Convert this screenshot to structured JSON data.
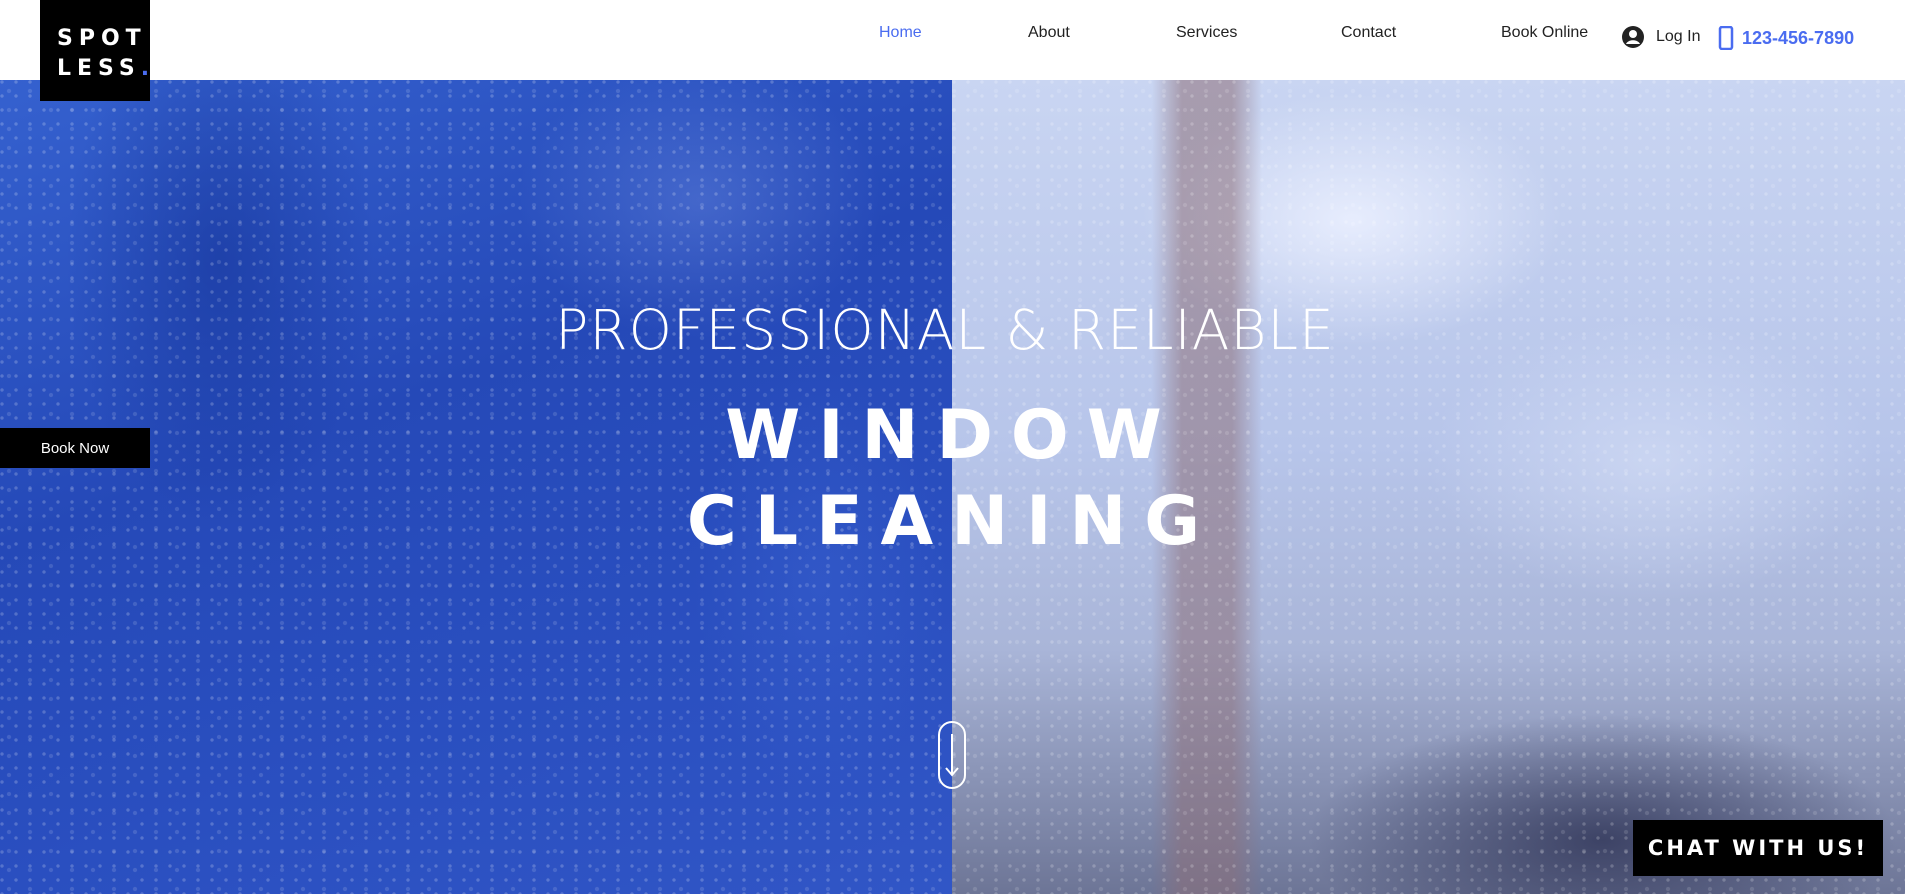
{
  "logo": {
    "line1": "SPOT",
    "line2": "LESS",
    "dot": "."
  },
  "nav": {
    "items": [
      {
        "label": "Home",
        "active": true
      },
      {
        "label": "About",
        "active": false
      },
      {
        "label": "Services",
        "active": false
      },
      {
        "label": "Contact",
        "active": false
      },
      {
        "label": "Book Online",
        "active": false
      }
    ],
    "login_label": "Log In",
    "phone": "123-456-7890"
  },
  "hero": {
    "subtitle": "PROFESSIONAL & RELIABLE",
    "title_line1": "WINDOW",
    "title_line2": "CLEANING",
    "book_now_label": "Book Now"
  },
  "chat": {
    "label": "CHAT WITH US!"
  },
  "colors": {
    "accent": "#4a6cf0",
    "hero_left": "#2a4fc0",
    "hero_right": "#b7c5ea",
    "button_bg": "#000000"
  },
  "icons": {
    "user": "user-icon",
    "phone": "phone-icon",
    "scroll": "scroll-down-icon"
  }
}
